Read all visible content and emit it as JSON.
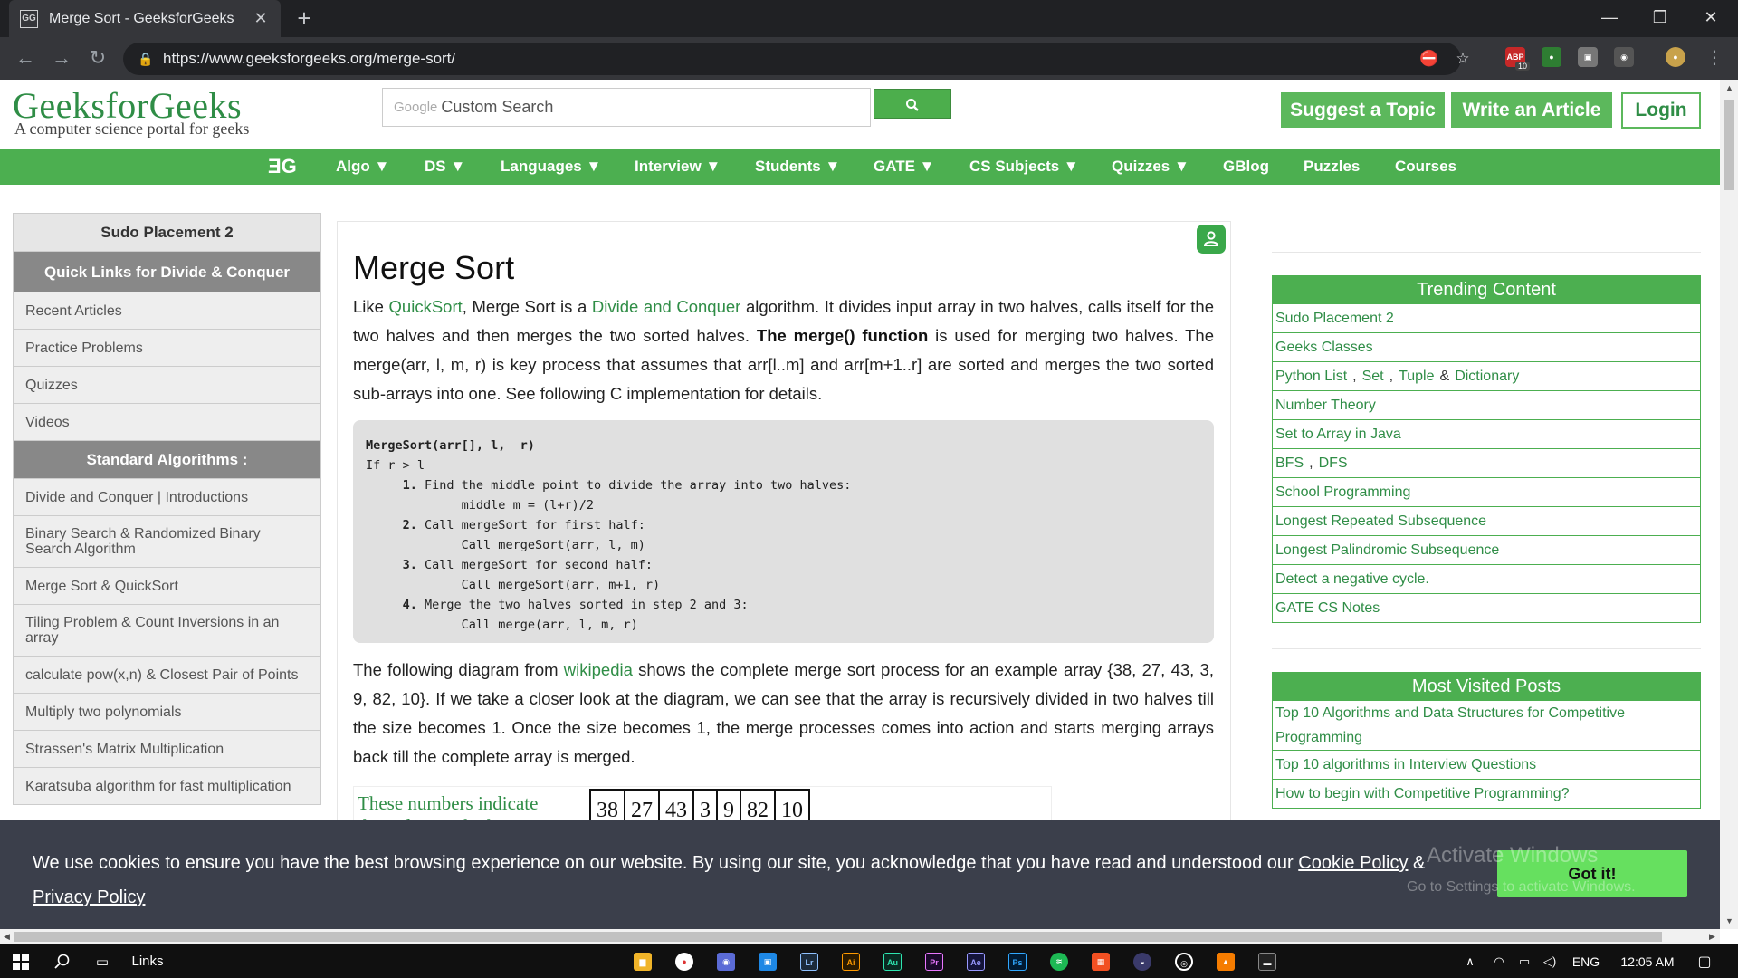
{
  "browser": {
    "tab_title": "Merge Sort - GeeksforGeeks",
    "favicon_text": "GG",
    "url": "https://www.geeksforgeeks.org/merge-sort/",
    "ext_badge": "10",
    "ext_label": "ABP"
  },
  "header": {
    "logo": "GeeksforGeeks",
    "tagline": "A computer science portal for geeks",
    "search_brand": "Google",
    "search_placeholder": "Custom Search",
    "suggest": "Suggest a Topic",
    "write": "Write an Article",
    "login": "Login"
  },
  "nav": {
    "home_icon": "ƎG",
    "items": [
      "Algo ▼",
      "DS ▼",
      "Languages ▼",
      "Interview ▼",
      "Students ▼",
      "GATE ▼",
      "CS Subjects ▼",
      "Quizzes ▼",
      "GBlog",
      "Puzzles",
      "Courses"
    ]
  },
  "left_sidebar": {
    "title": "Sudo Placement 2",
    "quick_links": "Quick Links for Divide & Conquer",
    "links1": [
      "Recent Articles",
      "Practice Problems",
      "Quizzes",
      "Videos"
    ],
    "section": "Standard Algorithms :",
    "links2": [
      "Divide and Conquer | Introductions",
      "Binary Search & Randomized Binary Search Algorithm",
      "Merge Sort & QuickSort",
      "Tiling Problem & Count Inversions in an array",
      "calculate pow(x,n) & Closest Pair of Points",
      "Multiply two polynomials",
      "Strassen's Matrix Multiplication",
      "Karatsuba algorithm for fast multiplication"
    ]
  },
  "article": {
    "title": "Merge Sort",
    "p1": {
      "t1": "Like ",
      "l1": "QuickSort",
      "t2": ", Merge Sort is a ",
      "l2": "Divide and Conquer",
      "t3": " algorithm. It divides input array in two halves, calls itself for the two halves and then merges the two sorted halves. ",
      "b1": "The merge() function",
      "t4": " is used for merging two halves. The merge(arr, l, m, r) is key process that assumes that arr[l..m] and arr[m+1..r] are sorted and merges the two sorted sub-arrays into one. See following C implementation for details."
    },
    "code": {
      "l1": "MergeSort(arr[], l,  r)",
      "l2": "If r > l",
      "n1": "1.",
      "l3": " Find the middle point to divide the array into two halves:",
      "l4": "middle m = (l+r)/2",
      "n2": "2.",
      "l5": " Call mergeSort for first half:",
      "l6": "Call mergeSort(arr, l, m)",
      "n3": "3.",
      "l7": " Call mergeSort for second half:",
      "l8": "Call mergeSort(arr, m+1, r)",
      "n4": "4.",
      "l9": " Merge the two halves sorted in step 2 and 3:",
      "l10": "Call merge(arr, l, m, r)"
    },
    "p2": {
      "t1": "The following diagram from ",
      "l1": "wikipedia",
      "t2": " shows the complete merge sort process for an example array {38, 27, 43, 3, 9, 82, 10}. If we take a closer look at the diagram, we can see that the array is recursively divided in two halves till the size becomes 1. Once the size becomes 1, the merge processes comes into action and starts merging arrays back till the complete array is merged."
    },
    "diagram_note": "These numbers indicate the order in which",
    "array": [
      "38",
      "27",
      "43",
      "3",
      "9",
      "82",
      "10"
    ]
  },
  "right_sidebar": {
    "trending": {
      "head": "Trending Content",
      "rows": [
        [
          "Sudo Placement 2"
        ],
        [
          "Geeks Classes"
        ],
        [
          "Python List",
          "Set",
          "Tuple",
          "Dictionary"
        ],
        [
          "Number Theory"
        ],
        [
          "Set to Array in Java"
        ],
        [
          "BFS",
          "DFS"
        ],
        [
          "School Programming"
        ],
        [
          "Longest Repeated Subsequence"
        ],
        [
          "Longest Palindromic Subsequence"
        ],
        [
          "Detect a negative cycle."
        ],
        [
          "GATE CS Notes"
        ]
      ],
      "sep_comma": ",",
      "sep_amp": "&"
    },
    "most_visited": {
      "head": "Most Visited Posts",
      "rows": [
        "Top 10 Algorithms and Data Structures for Competitive Programming",
        "Top 10 algorithms in Interview Questions",
        "How to begin with Competitive Programming?"
      ]
    }
  },
  "cookie": {
    "text": "We use cookies to ensure you have the best browsing experience on our website. By using our site, you acknowledge that you have read and understood our ",
    "cookie_policy": "Cookie Policy",
    "amp": " & ",
    "privacy_policy": "Privacy Policy",
    "got_it": "Got it!",
    "activate1": "Activate Windows",
    "activate2": "Go to Settings to activate Windows."
  },
  "taskbar": {
    "links": "Links",
    "lang": "ENG",
    "time": "12:05 AM",
    "apps": [
      "Lr",
      "Ai",
      "Au",
      "Pr",
      "Ae",
      "Ps"
    ]
  },
  "colors": {
    "brand_green": "#2f8d46",
    "nav_green": "#4caf50",
    "button_green": "#5cb85c",
    "cookie_bg": "#3b3f4b",
    "got_it": "#66e05f"
  }
}
